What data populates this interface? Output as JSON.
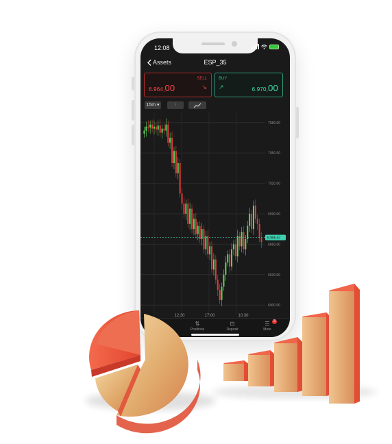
{
  "status": {
    "time": "12:08"
  },
  "nav": {
    "back_label": "Assets",
    "title": "ESP_35"
  },
  "sell": {
    "label": "SELL",
    "price_main": "6.964,",
    "price_big": "00"
  },
  "buy": {
    "label": "BUY",
    "price_main": "6.970,",
    "price_big": "00"
  },
  "toolbar": {
    "timeframe": "15m"
  },
  "chart_data": {
    "type": "candlestick",
    "y_ticks": [
      "7080.00",
      "7050.00",
      "7020.00",
      "6990.00",
      "6960.00",
      "6930.00",
      "6900.00"
    ],
    "x_ticks": [
      "12:30",
      "17:00",
      "10:30"
    ],
    "current_price_label": "6.966.57",
    "ylim": [
      6890,
      7090
    ]
  },
  "tabs": [
    {
      "label": "Positions",
      "icon": "arrows-icon"
    },
    {
      "label": "Deposit",
      "icon": "deposit-icon"
    },
    {
      "label": "More",
      "icon": "menu-icon",
      "badge": "3"
    }
  ],
  "colors": {
    "sell": "#e04040",
    "buy": "#2fbf8f",
    "bull": "#5fd35a",
    "bear": "#e03a3a",
    "gold": "#e2bc7a",
    "red_3d": "#ef5a44"
  }
}
